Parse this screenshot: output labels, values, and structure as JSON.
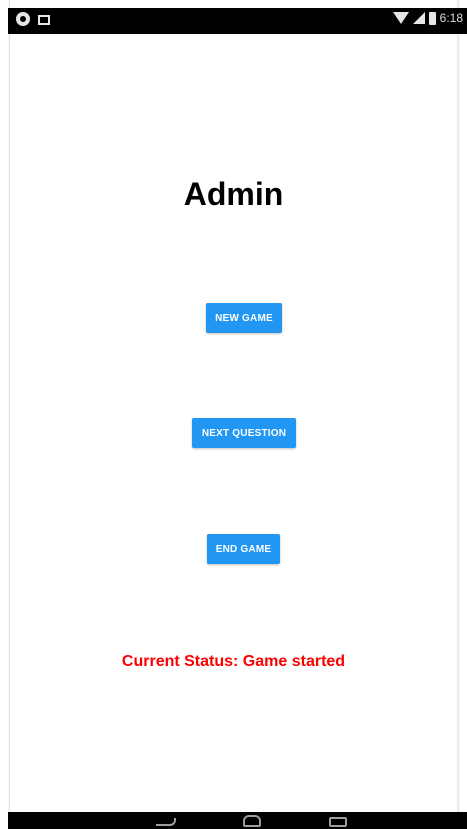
{
  "status_bar": {
    "time": "6:18",
    "icons": [
      "app-notification-icon",
      "image-icon",
      "wifi-icon",
      "signal-icon",
      "battery-icon"
    ]
  },
  "screen": {
    "title": "Admin",
    "buttons": {
      "new_game": "NEW GAME",
      "next_question": "NEXT QUESTION",
      "end_game": "END GAME"
    },
    "status": "Current Status: Game started"
  },
  "nav_bar": {
    "icons": [
      "back-icon",
      "home-icon",
      "recent-apps-icon"
    ]
  },
  "colors": {
    "button": "#2196f3",
    "status_text": "#ff0000",
    "bars": "#000000"
  }
}
